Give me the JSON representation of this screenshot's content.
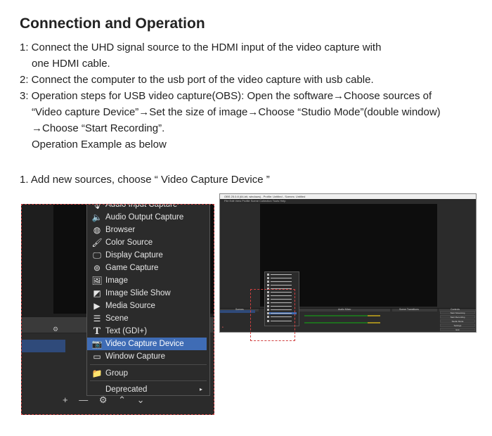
{
  "heading": "Connection and Operation",
  "steps": {
    "s1_a": "1: Connect the UHD signal source to the HDMI input of the video capture with",
    "s1_b": "one HDMI cable.",
    "s2": "2: Connect the computer to the usb port of the video capture with usb cable.",
    "s3_a": "3: Operation steps for USB video capture(OBS): Open the software→Choose sources of",
    "s3_b": "“Video capture Device”→Set the size of image→Choose “Studio Mode”(double window)",
    "s3_c": "→Choose “Start Recording”.",
    "s3_d": "Operation Example as below"
  },
  "example_caption": "1. Add new sources, choose “ Video Capture Device ”",
  "zoom_menu": {
    "items": [
      {
        "label": "Audio Input Capture",
        "icon": "microphone-icon"
      },
      {
        "label": "Audio Output Capture",
        "icon": "speaker-icon"
      },
      {
        "label": "Browser",
        "icon": "globe-icon"
      },
      {
        "label": "Color Source",
        "icon": "brush-icon"
      },
      {
        "label": "Display Capture",
        "icon": "monitor-icon"
      },
      {
        "label": "Game Capture",
        "icon": "gamepad-icon"
      },
      {
        "label": "Image",
        "icon": "image-icon"
      },
      {
        "label": "Image Slide Show",
        "icon": "slideshow-icon"
      },
      {
        "label": "Media Source",
        "icon": "play-icon"
      },
      {
        "label": "Scene",
        "icon": "list-icon"
      },
      {
        "label": "Text (GDI+)",
        "icon": "text-icon"
      },
      {
        "label": "Video Capture Device",
        "icon": "camera-icon"
      },
      {
        "label": "Window Capture",
        "icon": "window-icon"
      },
      {
        "label": "Group",
        "icon": "folder-icon"
      },
      {
        "label": "Deprecated",
        "icon": "chevron-right-icon"
      }
    ],
    "selected": "Video Capture Device",
    "bottom_controls": "+ — ⚙ ⌃ ⌄"
  },
  "obs_window": {
    "title": "OBS 25.0.8 (64-bit, windows) - Profile: Untitled - Scenes: Untitled",
    "menu": "File  Edit  View  Profile  Scene Collection  Tools  Help",
    "docks": [
      "Scenes",
      "Sources",
      "Audio Mixer",
      "Scene Transitions",
      "Controls"
    ],
    "buttons": [
      "Start Streaming",
      "Start Recording",
      "Studio Mode",
      "Settings",
      "Exit"
    ]
  },
  "colors": {
    "accent": "#3f6cb5",
    "highlight_border": "#d24040"
  }
}
